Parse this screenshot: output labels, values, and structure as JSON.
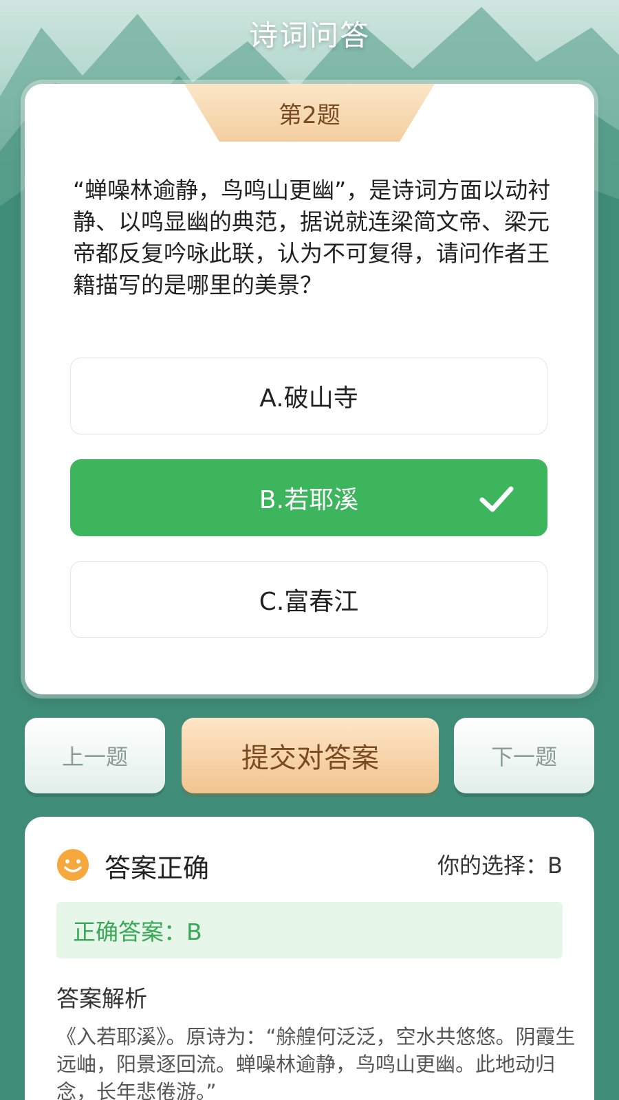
{
  "header": {
    "title": "诗词问答"
  },
  "question": {
    "number_label": "第2题",
    "text": "“蝉噪林逾静，鸟鸣山更幽”，是诗词方面以动衬静、以鸣显幽的典范，据说就连梁简文帝、梁元帝都反复吟咏此联，认为不可复得，请问作者王籍描写的是哪里的美景？",
    "options": [
      {
        "label": "A.破山寺",
        "state": "normal"
      },
      {
        "label": "B.若耶溪",
        "state": "correct-selected",
        "icon": "check-icon"
      },
      {
        "label": "C.富春江",
        "state": "normal"
      }
    ]
  },
  "nav": {
    "prev_label": "上一题",
    "submit_label": "提交对答案",
    "next_label": "下一题"
  },
  "result": {
    "icon": "smile-icon",
    "title": "答案正确",
    "your_choice": "你的选择：B",
    "correct_answer": "正确答案：B",
    "analysis_heading": "答案解析",
    "analysis_text": "《入若耶溪》。原诗为：“艅艎何泛泛，空水共悠悠。阴霞生远岫，阳景逐回流。蝉噪林逾静，鸟鸣山更幽。此地动归念，长年悲倦游。”"
  },
  "colors": {
    "background": "#3f8c78",
    "correct_green": "#3cb55d",
    "tab_gold": "#f3cf9f",
    "accent_brown": "#7a4a22"
  }
}
